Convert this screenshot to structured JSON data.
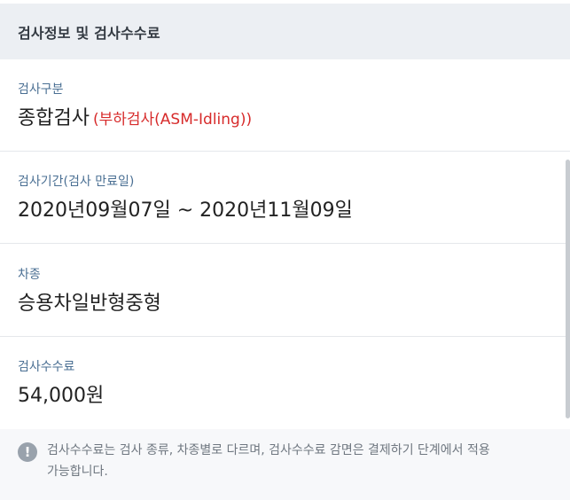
{
  "header": {
    "title": "검사정보 및 검사수수료"
  },
  "inspection_type": {
    "label": "검사구분",
    "value": "종합검사",
    "sub": "(부하검사(ASM-Idling))"
  },
  "inspection_period": {
    "label": "검사기간(검사 만료일)",
    "value": "2020년09월07일 ~ 2020년11월09일"
  },
  "vehicle_type": {
    "label": "차종",
    "value": "승용차일반형중형"
  },
  "inspection_fee": {
    "label": "검사수수료",
    "value": "54,000원"
  },
  "notice": {
    "icon": "info-icon",
    "text": "검사수수료는 검사 종류, 차종별로 다르며, 검사수수료 감면은 결제하기 단계에서 적용 가능합니다."
  },
  "colors": {
    "label": "#4a6f93",
    "accent_red": "#d72b2b",
    "header_bg": "#eceff3"
  }
}
